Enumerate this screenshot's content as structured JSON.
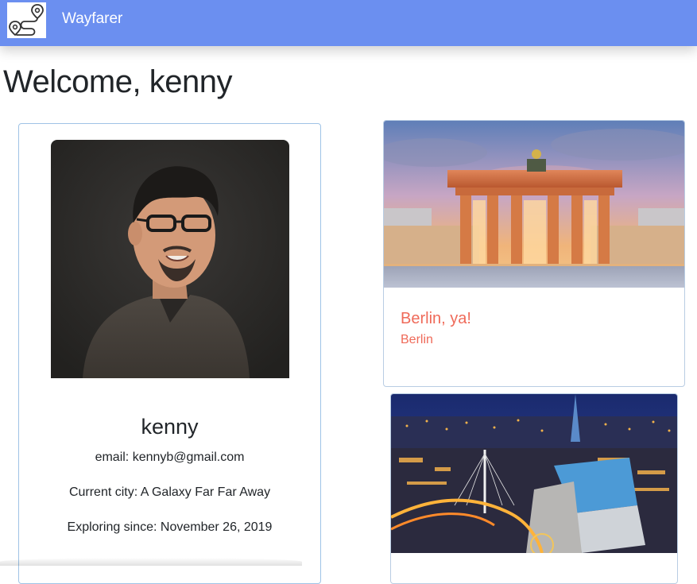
{
  "navbar": {
    "brand": "Wayfarer",
    "logo_icon": "map-route-icon",
    "color": "#6b8ff0"
  },
  "page": {
    "welcome": "Welcome, kenny"
  },
  "profile": {
    "avatar_icon": "profile-photo",
    "name": "kenny",
    "email": "email: kennyb@gmail.com",
    "current_city": "Current city: A Galaxy Far Far Away",
    "exploring_since": "Exploring since: November 26, 2019"
  },
  "posts": [
    {
      "image": "brandenburg-gate-photo",
      "title": "Berlin, ya!",
      "city": "Berlin"
    },
    {
      "image": "winnipeg-night-skyline-photo",
      "title": "",
      "city": ""
    }
  ],
  "colors": {
    "accent_text": "#ef6a59",
    "card_border": "#9fc3e6"
  }
}
